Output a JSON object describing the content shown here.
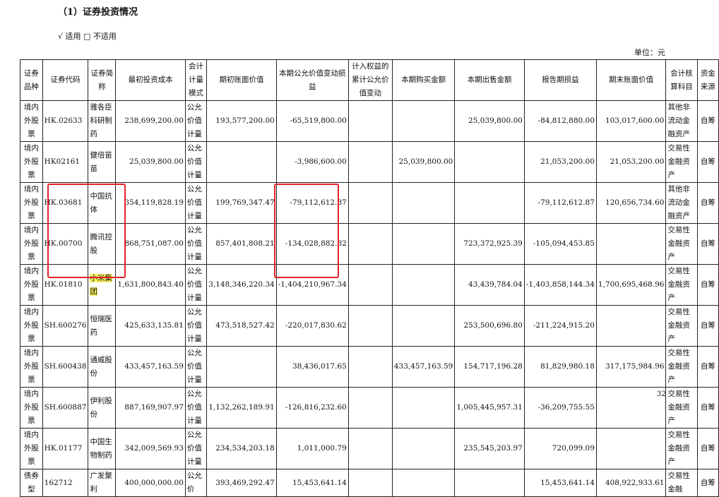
{
  "heading": "（1）证券投资情况",
  "applicable": "√ 适用 □ 不适用",
  "unit": "单位：元",
  "page_number": "32",
  "columns": [
    "证券品种",
    "证券代码",
    "证券简称",
    "最初投资成本",
    "会计计量模式",
    "期初账面价值",
    "本期公允价值变动损益",
    "计入权益的累计公允价值变动",
    "本期购买金额",
    "本期出售金额",
    "报告期损益",
    "期末账面价值",
    "会计核算科目",
    "资金来源"
  ],
  "rows": [
    {
      "type": "境内外股票",
      "code": "HK.02633",
      "name": "雅各臣科研制药",
      "cost": "238,699,200.00",
      "mode": "公允价值计量",
      "begin": "193,577,200.00",
      "fv_change": "-65,519,800.00",
      "equity_fv": "",
      "buy": "",
      "sell": "25,039,800.00",
      "pnl": "-84,812,880.00",
      "end": "103,017,600.00",
      "account": "其他非流动金融资产",
      "source": "自筹"
    },
    {
      "type": "境内外股票",
      "code": "HK02161",
      "name": "健倍苗苗",
      "cost": "25,039,800.00",
      "mode": "公允价值计量",
      "begin": "",
      "fv_change": "-3,986,600.00",
      "equity_fv": "",
      "buy": "25,039,800.00",
      "sell": "",
      "pnl": "21,053,200.00",
      "end": "21,053,200.00",
      "account": "交易性金融资产",
      "source": "自筹"
    },
    {
      "type": "境内外股票",
      "code": "HK.03681",
      "name": "中国抗体",
      "cost": "354,119,828.19",
      "mode": "公允价值计量",
      "begin": "199,769,347.47",
      "fv_change": "-79,112,612.87",
      "equity_fv": "",
      "buy": "",
      "sell": "",
      "pnl": "-79,112,612.87",
      "end": "120,656,734.60",
      "account": "其他非流动金融资产",
      "source": "自筹"
    },
    {
      "type": "境内外股票",
      "code": "HK.00700",
      "name": "腾讯控股",
      "cost": "868,751,087.00",
      "mode": "公允价值计量",
      "begin": "857,401,808.21",
      "fv_change": "-134,028,882.82",
      "equity_fv": "",
      "buy": "",
      "sell": "723,372,925.39",
      "pnl": "-105,094,453.85",
      "end": "",
      "account": "交易性金融资产",
      "source": "自筹"
    },
    {
      "type": "境内外股票",
      "code": "HK.01810",
      "name": "小米集团",
      "cost": "1,631,800,843.40",
      "mode": "公允价值计量",
      "begin": "3,148,346,220.34",
      "fv_change": "-1,404,210,967.34",
      "equity_fv": "",
      "buy": "",
      "sell": "43,439,784.04",
      "pnl": "-1,403,858,144.34",
      "end": "1,700,695,468.96",
      "account": "交易性金融资产",
      "source": "自筹"
    },
    {
      "type": "境内外股票",
      "code": "SH.600276",
      "name": "恒瑞医药",
      "cost": "425,633,135.81",
      "mode": "公允价值计量",
      "begin": "473,518,527.42",
      "fv_change": "-220,017,830.62",
      "equity_fv": "",
      "buy": "",
      "sell": "253,500,696.80",
      "pnl": "-211,224,915.20",
      "end": "",
      "account": "交易性金融资产",
      "source": "自筹"
    },
    {
      "type": "境内外股票",
      "code": "SH.600438",
      "name": "通威股份",
      "cost": "433,457,163.59",
      "mode": "公允价值计量",
      "begin": "",
      "fv_change": "38,436,017.65",
      "equity_fv": "",
      "buy": "433,457,163.59",
      "sell": "154,717,196.28",
      "pnl": "81,829,980.18",
      "end": "317,175,984.96",
      "account": "交易性金融资产",
      "source": "自筹"
    },
    {
      "type": "境内外股票",
      "code": "SH.600887",
      "name": "伊利股份",
      "cost": "887,169,907.97",
      "mode": "公允价值计量",
      "begin": "1,132,262,189.91",
      "fv_change": "-126,816,232.60",
      "equity_fv": "",
      "buy": "",
      "sell": "1,005,445,957.31",
      "pnl": "-36,209,755.55",
      "end": "",
      "account": "交易性金融资产",
      "source": "自筹"
    },
    {
      "type": "境内外股票",
      "code": "HK.01177",
      "name": "中国生物制药",
      "cost": "342,009,569.93",
      "mode": "公允价值计量",
      "begin": "234,534,203.18",
      "fv_change": "1,011,000.79",
      "equity_fv": "",
      "buy": "",
      "sell": "235,545,203.97",
      "pnl": "720,099.09",
      "end": "",
      "account": "交易性金融资产",
      "source": "自筹"
    },
    {
      "type": "债券型",
      "code": "162712",
      "name": "广发聚利",
      "cost": "400,000,000.00",
      "mode": "公允价",
      "begin": "393,469,292.47",
      "fv_change": "15,453,641.14",
      "equity_fv": "",
      "buy": "",
      "sell": "",
      "pnl": "15,453,641.14",
      "end": "408,922,933.61",
      "account": "交易性金融",
      "source": "自筹"
    }
  ],
  "highlight_color": "#f4f062",
  "annotation_color": "#e5202a"
}
